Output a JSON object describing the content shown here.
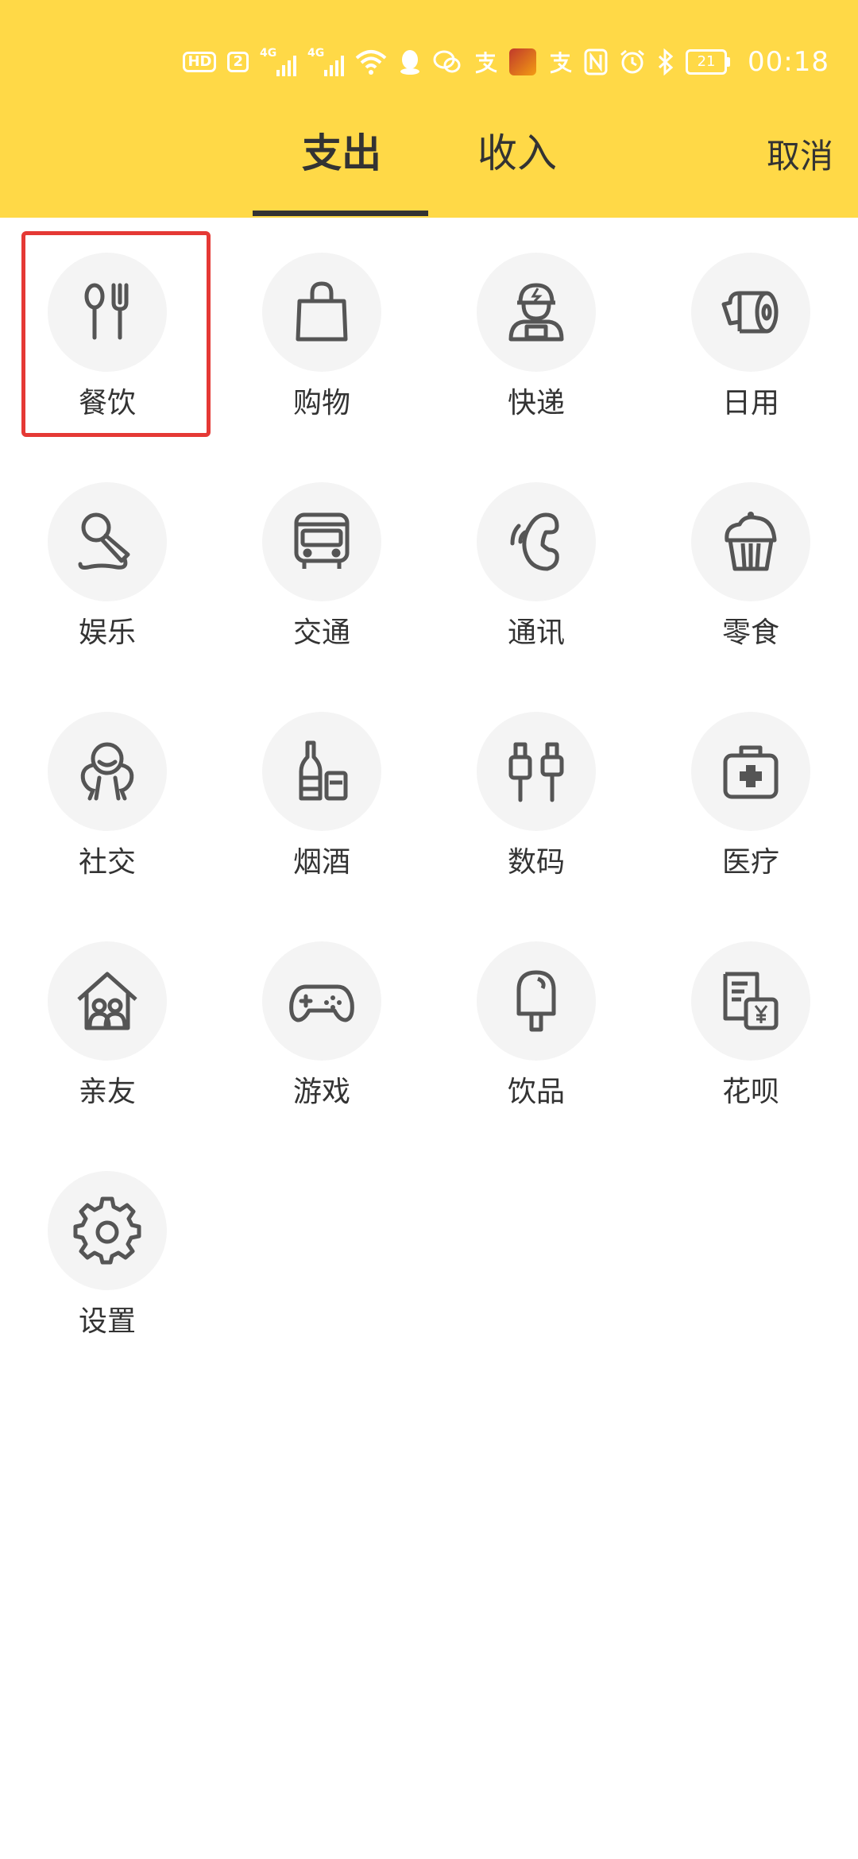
{
  "status_bar": {
    "hd": "HD",
    "sim": "2",
    "net1": "4G",
    "net2": "4G",
    "battery": "21",
    "time": "00:18",
    "icons": [
      "hd-icon",
      "sim-2-icon",
      "signal-4g-icon",
      "signal-4g-icon",
      "wifi-icon",
      "qq-icon",
      "chat-icon",
      "alipay-icon",
      "game-avatar-icon",
      "alipay-icon",
      "nfc-icon",
      "alarm-icon",
      "bluetooth-icon",
      "battery-icon"
    ]
  },
  "header": {
    "tabs": [
      {
        "label": "支出",
        "active": true
      },
      {
        "label": "收入",
        "active": false
      }
    ],
    "cancel_label": "取消",
    "background_color": "#FFD947"
  },
  "categories": [
    {
      "label": "餐饮",
      "icon": "utensils-icon",
      "selected": true
    },
    {
      "label": "购物",
      "icon": "shopping-bag-icon"
    },
    {
      "label": "快递",
      "icon": "courier-icon"
    },
    {
      "label": "日用",
      "icon": "toilet-paper-icon"
    },
    {
      "label": "娱乐",
      "icon": "microphone-icon"
    },
    {
      "label": "交通",
      "icon": "bus-icon"
    },
    {
      "label": "通讯",
      "icon": "phone-icon"
    },
    {
      "label": "零食",
      "icon": "cupcake-icon"
    },
    {
      "label": "社交",
      "icon": "social-icon"
    },
    {
      "label": "烟酒",
      "icon": "tobacco-alcohol-icon"
    },
    {
      "label": "数码",
      "icon": "cable-icon"
    },
    {
      "label": "医疗",
      "icon": "medical-kit-icon"
    },
    {
      "label": "亲友",
      "icon": "family-house-icon"
    },
    {
      "label": "游戏",
      "icon": "gamepad-icon"
    },
    {
      "label": "饮品",
      "icon": "popsicle-icon"
    },
    {
      "label": "花呗",
      "icon": "bill-icon"
    },
    {
      "label": "设置",
      "icon": "gear-icon"
    }
  ],
  "highlight_color": "#E53935"
}
